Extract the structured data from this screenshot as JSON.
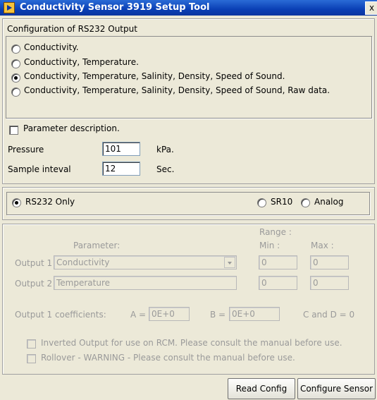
{
  "window": {
    "title": "Conductivity Sensor 3919 Setup Tool",
    "close_label": "x",
    "icon": "labview-run-icon"
  },
  "rs232": {
    "heading": "Configuration of RS232 Output",
    "options": [
      {
        "label": "Conductivity.",
        "selected": false
      },
      {
        "label": "Conductivity, Temperature.",
        "selected": false
      },
      {
        "label": "Conductivity, Temperature, Salinity, Density, Speed of Sound.",
        "selected": true
      },
      {
        "label": "Conductivity, Temperature, Salinity, Density, Speed of Sound, Raw data.",
        "selected": false
      }
    ],
    "param_desc_label": "Parameter description.",
    "param_desc_checked": false,
    "pressure_label": "Pressure",
    "pressure_value": "101",
    "pressure_unit": "kPa.",
    "interval_label": "Sample inteval",
    "interval_value": "12",
    "interval_unit": "Sec."
  },
  "mode": {
    "rs232_only": "RS232 Only",
    "sr10": "SR10",
    "analog": "Analog",
    "selected": "rs232_only"
  },
  "analog": {
    "range_label": "Range :",
    "parameter_label": "Parameter:",
    "min_label": "Min :",
    "max_label": "Max :",
    "outputs": [
      {
        "label": "Output 1",
        "parameter": "Conductivity",
        "min": "0",
        "max": "0"
      },
      {
        "label": "Output 2",
        "parameter": "Temperature",
        "min": "0",
        "max": "0"
      }
    ],
    "coeff_label": "Output 1 coefficients:",
    "a_label": "A =",
    "a_value": "0E+0",
    "b_label": "B =",
    "b_value": "0E+0",
    "cd_label": "C and D = 0",
    "inverted_label": "Inverted Output for use on RCM. Please consult the manual before use.",
    "rollover_label": "Rollover - WARNING - Please consult the manual before use."
  },
  "buttons": {
    "read_config": "Read Config",
    "configure_sensor": "Configure Sensor"
  }
}
